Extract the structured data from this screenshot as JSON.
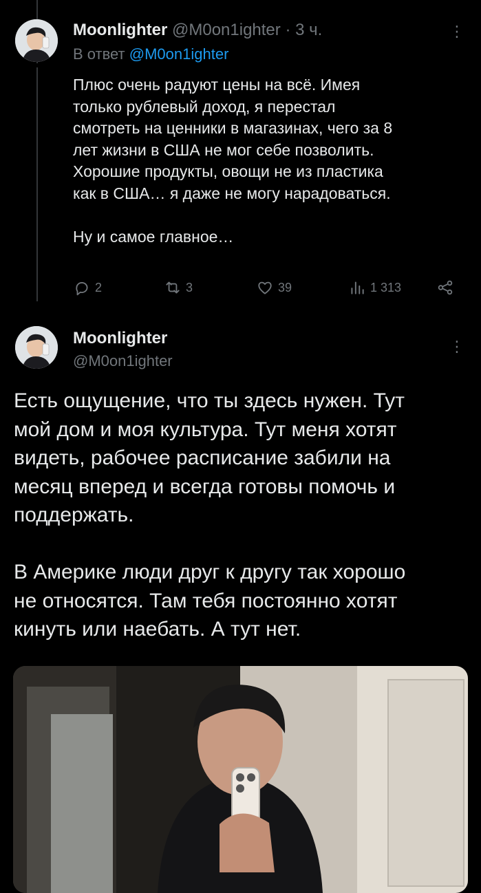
{
  "reply_tweet": {
    "author_name": "Moonlighter",
    "author_handle": "@M0on1ighter",
    "separator": "·",
    "time": "3 ч.",
    "reply_prefix": "В ответ",
    "reply_to": "@M0on1ighter",
    "text": "Плюс очень радуют цены на всё. Имея\nтолько рублевый доход, я перестал\nсмотреть на ценники в магазинах, чего за 8\nлет жизни в США не мог себе позволить.\nХорошие продукты, овощи не из пластика\nкак в США… я даже не могу нарадоваться.\n\nНу и самое главное…",
    "replies": "2",
    "retweets": "3",
    "likes": "39",
    "views": "1 313"
  },
  "main_tweet": {
    "author_name": "Moonlighter",
    "author_handle": "@M0on1ighter",
    "text": "Есть ощущение, что ты здесь нужен. Тут\nмой дом и моя культура. Тут меня хотят\nвидеть, рабочее расписание забили на\nмесяц вперед и всегда готовы помочь и\nподдержать.\n\nВ Америке люди друг к другу так хорошо\nне относятся. Там тебя постоянно хотят\nкинуть или наебать. А тут нет."
  },
  "icons": {
    "more": "more-vertical-icon",
    "reply": "reply-icon",
    "retweet": "retweet-icon",
    "like": "heart-icon",
    "views": "views-chart-icon",
    "share": "share-icon"
  },
  "colors": {
    "background": "#000000",
    "text": "#e7e9ea",
    "muted": "#71767b",
    "accent": "#1d9bf0"
  }
}
